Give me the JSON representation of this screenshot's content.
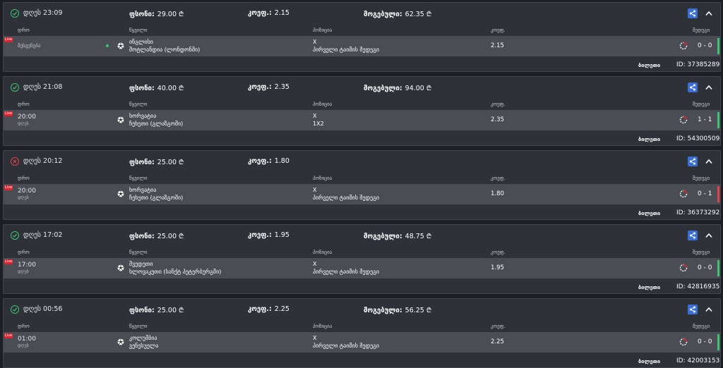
{
  "columns": {
    "time": "დრო",
    "event": "წყვილი",
    "position": "პოზიცია",
    "odd": "კოეფ.",
    "result": "შედეგი"
  },
  "labels": {
    "stake": "ფსონი:",
    "odds": "კოეფ.:",
    "win": "მოგებული:",
    "ticket": "ბილეთი",
    "id": "ID:",
    "live": "Live"
  },
  "colors": {
    "won": "#3ec26f",
    "lost": "#e0434b",
    "share": "#3a6fd8",
    "live": "#e0232c"
  },
  "bets": [
    {
      "status": "won",
      "status_icon": "check-circle-icon",
      "date": "დღეს 23:09",
      "stake": "29.00 ₾",
      "odds": "2.15",
      "win": "62.35 ₾",
      "row": {
        "time": "",
        "sub": "",
        "status_text": "შესვენება",
        "team1": "ინგლისი",
        "team2": "შოტლანდია (ლონდონში)",
        "pick1": "X",
        "pick2": "პირველი ტაიმის შედეგი",
        "odd": "2.15",
        "score": "0 - 0"
      },
      "ticket_id": "37385289"
    },
    {
      "status": "won",
      "status_icon": "check-circle-icon",
      "date": "დღეს 21:08",
      "stake": "40.00 ₾",
      "odds": "2.35",
      "win": "94.00 ₾",
      "row": {
        "time": "20:00",
        "sub": "დღეს",
        "status_text": "",
        "team1": "ხორვატია",
        "team2": "ჩეხეთი (გლაზგოში)",
        "pick1": "X",
        "pick2": "1X2",
        "odd": "2.35",
        "score": "1 - 1"
      },
      "ticket_id": "54300509"
    },
    {
      "status": "lost",
      "status_icon": "x-circle-icon",
      "date": "დღეს 20:12",
      "stake": "25.00 ₾",
      "odds": "1.80",
      "win": "",
      "row": {
        "time": "20:00",
        "sub": "დღეს",
        "status_text": "",
        "team1": "ხორვატია",
        "team2": "ჩეხეთი (გლაზგოში)",
        "pick1": "X",
        "pick2": "პირველი ტაიმის შედეგი",
        "odd": "1.80",
        "score": "0 - 1"
      },
      "ticket_id": "36373292"
    },
    {
      "status": "won",
      "status_icon": "check-circle-icon",
      "date": "დღეს 17:02",
      "stake": "25.00 ₾",
      "odds": "1.95",
      "win": "48.75 ₾",
      "row": {
        "time": "17:00",
        "sub": "დღეს",
        "status_text": "",
        "team1": "შვედეთი",
        "team2": "სლოვაკეთი (სანქტ პეტერბურგში)",
        "pick1": "X",
        "pick2": "პირველი ტაიმის შედეგი",
        "odd": "1.95",
        "score": "0 - 0"
      },
      "ticket_id": "42816935"
    },
    {
      "status": "won",
      "status_icon": "check-circle-icon",
      "date": "დღეს 00:56",
      "stake": "25.00 ₾",
      "odds": "2.25",
      "win": "56.25 ₾",
      "row": {
        "time": "01:00",
        "sub": "დღეს",
        "status_text": "",
        "team1": "კოლუმბია",
        "team2": "ვენესუელა",
        "pick1": "X",
        "pick2": "პირველი ტაიმის შედეგი",
        "odd": "2.25",
        "score": "0 - 0"
      },
      "ticket_id": "42003153"
    }
  ]
}
